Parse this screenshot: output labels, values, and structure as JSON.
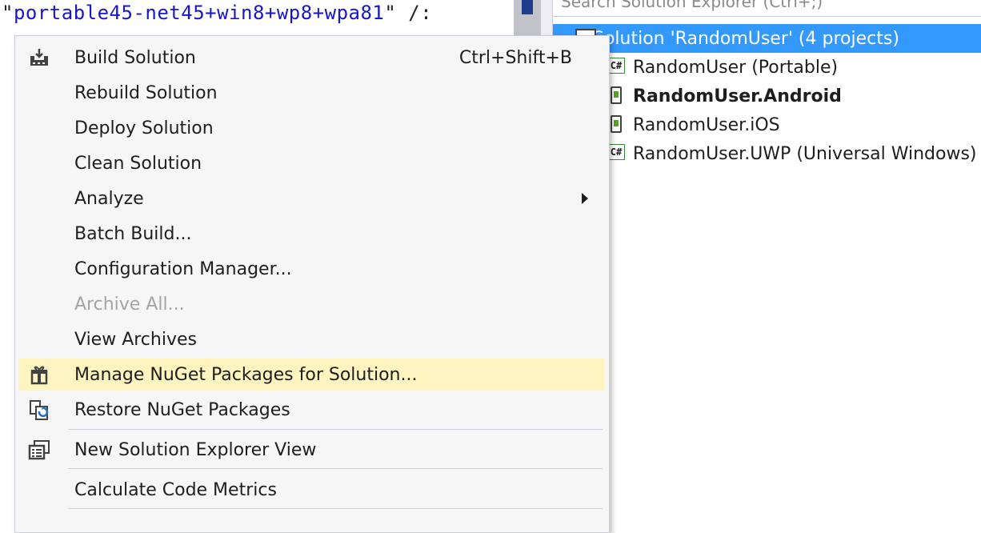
{
  "editor": {
    "quote_open": "\"",
    "code_value": "portable45-net45+win8+wp8+wpa81",
    "quote_close_tail": "\" /:"
  },
  "solution_explorer": {
    "search_placeholder": "Search Solution Explorer (Ctrl+;)",
    "items": [
      {
        "label": "Solution 'RandomUser' (4 projects)",
        "icon": "solution-icon",
        "selected": true
      },
      {
        "label": "RandomUser (Portable)",
        "icon": "csharp-project-icon"
      },
      {
        "label": "RandomUser.Android",
        "icon": "android-project-icon",
        "bold": true
      },
      {
        "label": "RandomUser.iOS",
        "icon": "ios-project-icon"
      },
      {
        "label": "RandomUser.UWP (Universal Windows)",
        "icon": "csharp-project-icon"
      }
    ]
  },
  "context_menu": {
    "items": [
      {
        "label": "Build Solution",
        "shortcut": "Ctrl+Shift+B",
        "icon": "build-solution-icon"
      },
      {
        "label": "Rebuild Solution"
      },
      {
        "label": "Deploy Solution"
      },
      {
        "label": "Clean Solution"
      },
      {
        "label": "Analyze",
        "submenu": true
      },
      {
        "label": "Batch Build..."
      },
      {
        "label": "Configuration Manager..."
      },
      {
        "label": "Archive All...",
        "disabled": true
      },
      {
        "label": "View Archives"
      },
      {
        "label": "Manage NuGet Packages for Solution...",
        "icon": "nuget-package-icon",
        "highlighted": true
      },
      {
        "label": "Restore NuGet Packages",
        "icon": "restore-packages-icon"
      },
      {
        "label": "New Solution Explorer View",
        "icon": "new-explorer-view-icon"
      },
      {
        "label": "Calculate Code Metrics"
      }
    ]
  },
  "colors": {
    "selection": "#3399ff",
    "highlight": "#fdf4bf",
    "code_string": "#1717c8",
    "disabled_text": "#a2a4a5"
  }
}
